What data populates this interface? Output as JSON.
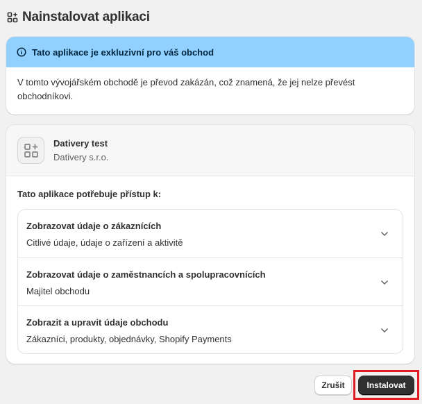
{
  "header": {
    "title": "Nainstalovat aplikaci",
    "icon": "apps-add-icon"
  },
  "banner": {
    "title": "Tato aplikace je exkluzivní pro váš obchod",
    "body": "V tomto vývojářském obchodě je převod zakázán, což znamená, že jej nelze převést obchodníkovi.",
    "color": "#91d0ff",
    "icon": "info-icon"
  },
  "app": {
    "name": "Dativery test",
    "vendor": "Dativery s.r.o.",
    "icon": "apps-add-icon"
  },
  "access": {
    "label": "Tato aplikace potřebuje přístup k:",
    "permissions": [
      {
        "title": "Zobrazovat údaje o zákaznících",
        "description": "Citlivé údaje, údaje o zařízení a aktivitě"
      },
      {
        "title": "Zobrazovat údaje o zaměstnancích a spolupracovnících",
        "description": "Majitel obchodu"
      },
      {
        "title": "Zobrazit a upravit údaje obchodu",
        "description": "Zákazníci, produkty, objednávky, Shopify Payments"
      }
    ]
  },
  "footer": {
    "cancel_label": "Zrušit",
    "install_label": "Instalovat",
    "highlight_color": "#e01b24"
  }
}
